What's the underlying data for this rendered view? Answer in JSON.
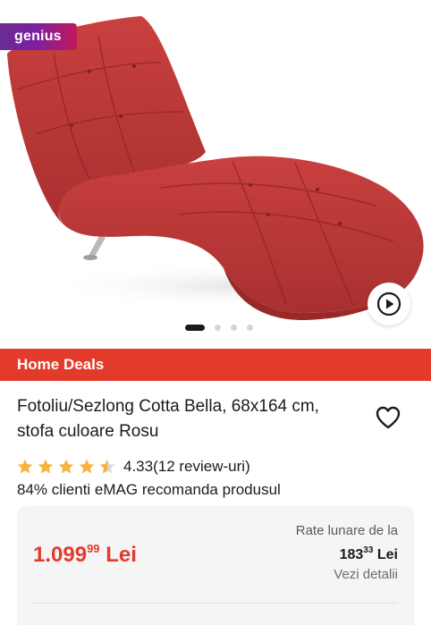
{
  "gallery": {
    "badge": "genius",
    "image_count": 4,
    "active_image_index": 0
  },
  "deal_banner": "Home Deals",
  "product": {
    "title": "Fotoliu/Sezlong Cotta Bella, 68x164 cm, stofa culoare Rosu",
    "rating": "4.33",
    "rating_value": 4.33,
    "review_count": "(12 review-uri)",
    "recommend_text": "84% clienti eMAG recomanda produsul"
  },
  "price": {
    "integer": "1.099",
    "decimals": "99",
    "currency": "Lei",
    "installments_label": "Rate lunare de la",
    "installment_integer": "183",
    "installment_decimals": "33",
    "installment_currency": "Lei",
    "details_link": "Vezi detalii"
  },
  "colors": {
    "accent_red": "#e23b2b",
    "star_gold": "#f6b33d",
    "genius_purple": "#7b1fa2"
  },
  "icons": {
    "heart": "heart-outline-icon",
    "play": "play-circle-icon",
    "star": "star-icon"
  }
}
